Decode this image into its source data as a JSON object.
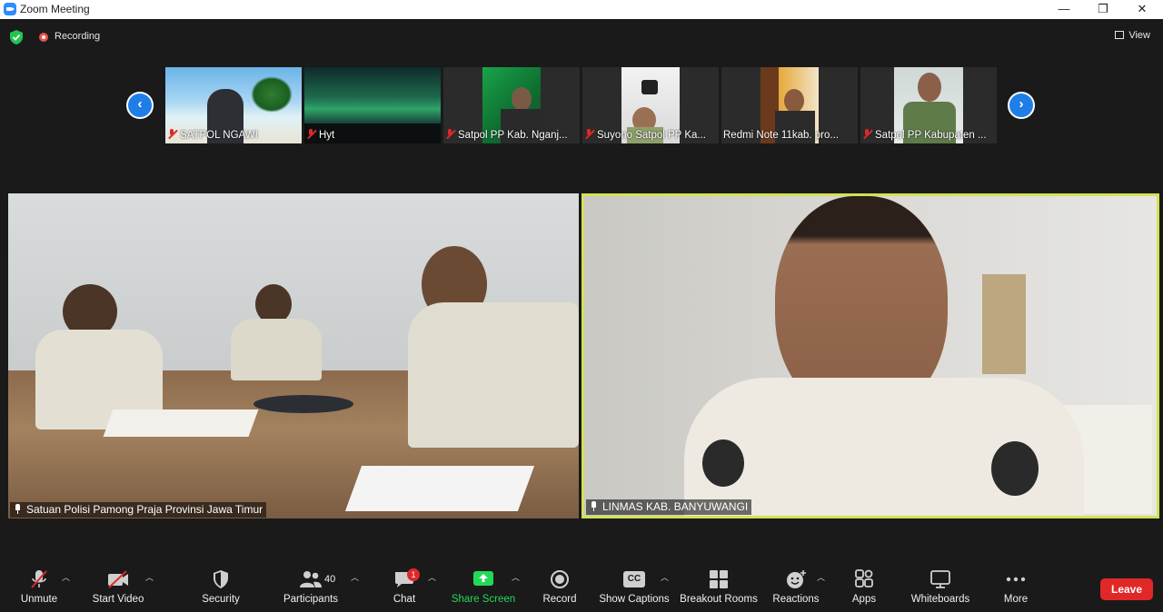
{
  "window": {
    "title": "Zoom Meeting",
    "minimize": "—",
    "restore": "❐",
    "close": "✕"
  },
  "topbar": {
    "recording": "Recording",
    "view": "View"
  },
  "thumbnails": [
    {
      "name": "SATPOL NGAWI"
    },
    {
      "name": "Hyt"
    },
    {
      "name": "Satpol PP Kab. Nganj..."
    },
    {
      "name": "Suyono Satpol PP Ka..."
    },
    {
      "name": "Redmi Note 11kab. pro..."
    },
    {
      "name": "Satpol PP Kabupaten ..."
    }
  ],
  "nav": {
    "prev": "‹",
    "next": "›"
  },
  "videos": {
    "left": {
      "name": "Satuan Polisi Pamong Praja Provinsi Jawa Timur"
    },
    "right": {
      "name": "LINMAS KAB. BANYUWANGI",
      "active_speaker_color": "#d4e157"
    }
  },
  "toolbar": {
    "unmute": "Unmute",
    "start_video": "Start Video",
    "security": "Security",
    "participants": "Participants",
    "participants_count": "40",
    "chat": "Chat",
    "chat_badge": "1",
    "share_screen": "Share Screen",
    "record": "Record",
    "show_captions": "Show Captions",
    "captions_icon": "CC",
    "breakout_rooms": "Breakout Rooms",
    "reactions": "Reactions",
    "apps": "Apps",
    "whiteboards": "Whiteboards",
    "more": "More",
    "leave": "Leave"
  },
  "colors": {
    "share_green": "#23d959",
    "leave_red": "#e02828",
    "accent_blue": "#1f7ee6"
  }
}
